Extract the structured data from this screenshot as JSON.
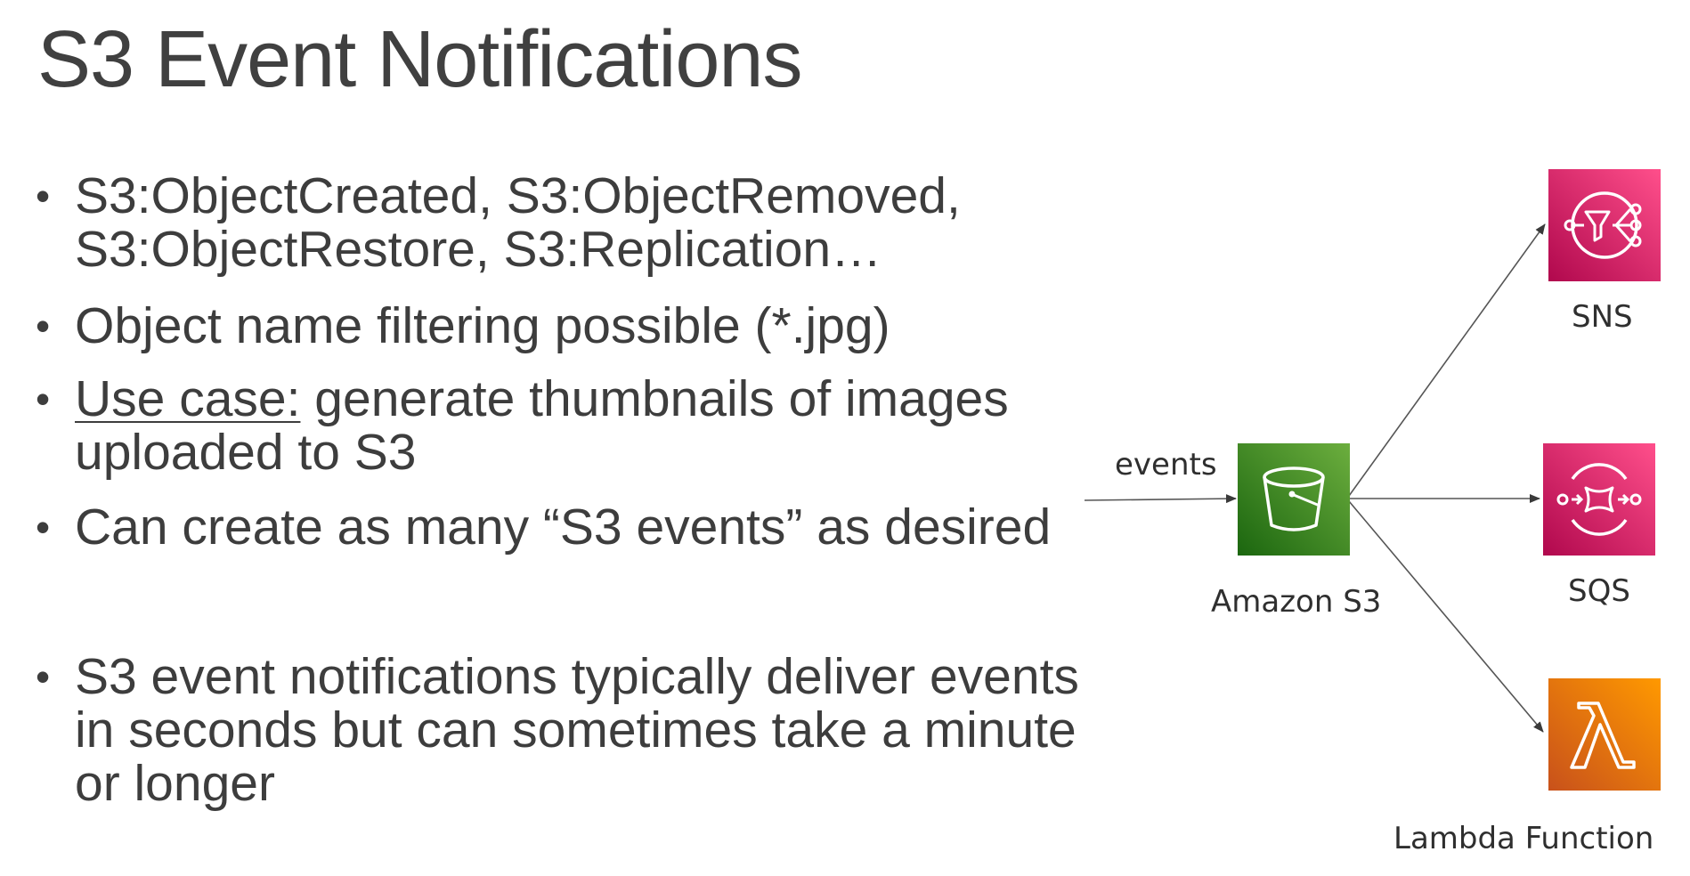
{
  "title": "S3 Event Notifications",
  "bullets": [
    {
      "lines": [
        "S3:ObjectCreated, S3:ObjectRemoved,",
        "S3:ObjectRestore, S3:Replication…"
      ]
    },
    {
      "lines": [
        "Object name filtering possible (*.jpg)"
      ]
    },
    {
      "underlined": "Use case:",
      "lines": [
        " generate thumbnails of images",
        "uploaded to S3"
      ]
    },
    {
      "lines": [
        "Can create as many “S3 events” as desired"
      ]
    },
    {
      "lines": [
        "S3 event notifications typically deliver events",
        "in seconds but can sometimes take a minute",
        "or longer"
      ]
    }
  ],
  "diagram": {
    "input_label": "events",
    "source": {
      "label": "Amazon S3",
      "icon": "s3-bucket-icon",
      "color": "#3f8624"
    },
    "targets": [
      {
        "label": "SNS",
        "icon": "sns-icon",
        "color": "#e7157b"
      },
      {
        "label": "SQS",
        "icon": "sqs-icon",
        "color": "#e7157b"
      },
      {
        "label": "Lambda Function",
        "icon": "lambda-icon",
        "color": "#ed7100"
      }
    ]
  }
}
